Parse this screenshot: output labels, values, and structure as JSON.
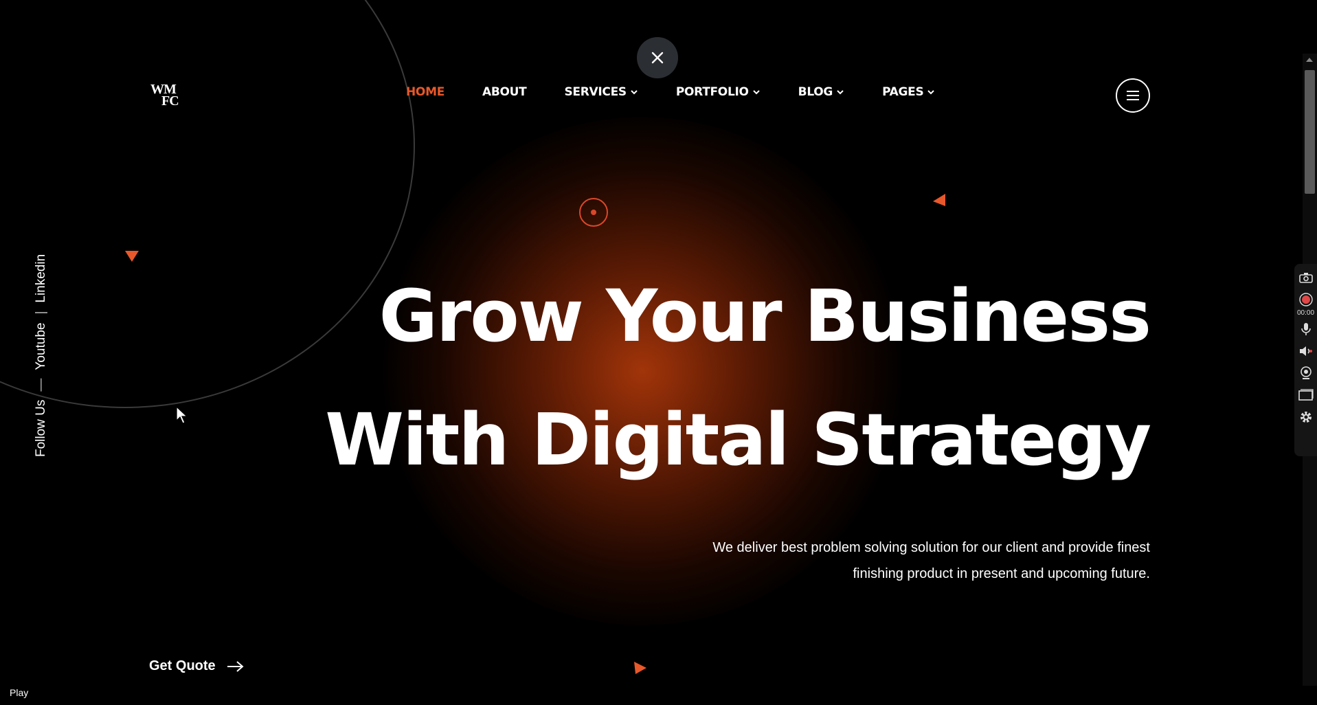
{
  "brand": {
    "logo_line1": "WM",
    "logo_line2": "FC"
  },
  "nav": {
    "items": [
      {
        "label": "HOME",
        "active": true,
        "dropdown": false
      },
      {
        "label": "ABOUT",
        "active": false,
        "dropdown": false
      },
      {
        "label": "SERVICES",
        "active": false,
        "dropdown": true
      },
      {
        "label": "PORTFOLIO",
        "active": false,
        "dropdown": true
      },
      {
        "label": "BLOG",
        "active": false,
        "dropdown": true
      },
      {
        "label": "PAGES",
        "active": false,
        "dropdown": true
      }
    ]
  },
  "social": {
    "follow_label": "Follow Us",
    "dash": "—",
    "youtube": "Youtube",
    "divider": "|",
    "linkedin": "Linkedin"
  },
  "hero": {
    "line1": "Grow Your Business",
    "line2": "With Digital Strategy",
    "sub_line1": "We deliver best problem solving solution for our client and provide finest",
    "sub_line2": "finishing product in present and upcoming future.",
    "cta_label": "Get Quote"
  },
  "recorder": {
    "timer": "00:00"
  },
  "player": {
    "play_label": "Play"
  },
  "colors": {
    "accent": "#e8582a",
    "background": "#000000",
    "glow": "#a9370a",
    "close_button_bg": "#2b2f33"
  }
}
